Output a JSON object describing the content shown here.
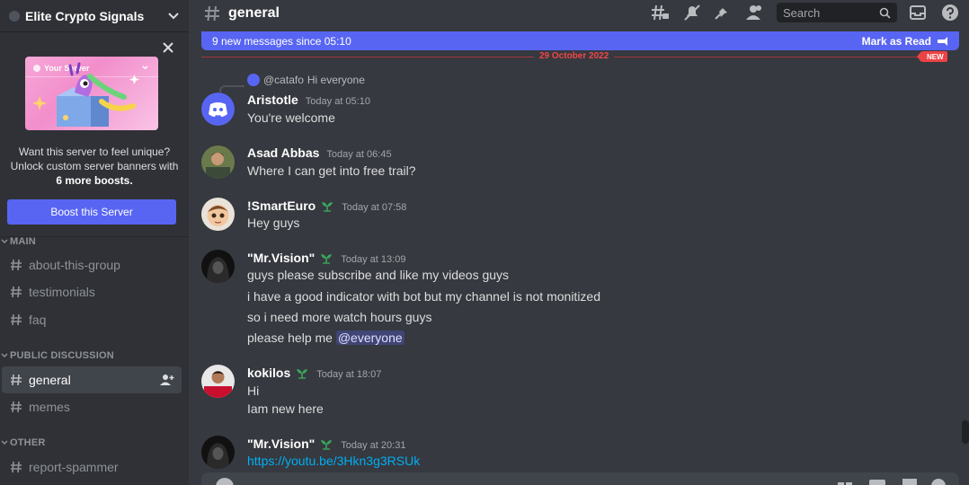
{
  "server": {
    "name": "Elite Crypto Signals"
  },
  "boost": {
    "preview_label": "Your Server",
    "line1": "Want this server to feel unique?",
    "line2": "Unlock custom server banners with",
    "line3": "6 more boosts.",
    "button": "Boost this Server"
  },
  "sidebar": {
    "categories": [
      {
        "label": "MAIN",
        "channels": [
          "about-this-group",
          "testimonials",
          "faq"
        ]
      },
      {
        "label": "PUBLIC DISCUSSION",
        "channels": [
          "general",
          "memes"
        ]
      },
      {
        "label": "OTHER",
        "channels": [
          "report-spammer"
        ]
      }
    ],
    "active_channel": "general"
  },
  "topbar": {
    "channel": "general",
    "search_placeholder": "Search",
    "icons": [
      "threads-icon",
      "mute-icon",
      "pin-icon",
      "members-icon",
      "inbox-icon",
      "help-icon"
    ]
  },
  "new_messages": {
    "text": "9 new messages since 05:10",
    "mark_read": "Mark as Read",
    "date": "29 October 2022",
    "tag": "NEW"
  },
  "reply": {
    "user": "@catafo",
    "text": "Hi everyone"
  },
  "messages": [
    {
      "author": "Aristotle",
      "time": "Today at 05:10",
      "lines": [
        "You're welcome"
      ]
    },
    {
      "author": "Asad Abbas",
      "time": "Today at 06:45",
      "lines": [
        "Where I can get into free trail?"
      ]
    },
    {
      "author": "!SmartEuro",
      "time": "Today at 07:58",
      "lines": [
        "Hey guys"
      ]
    },
    {
      "author": "\"Mr.Vision\"",
      "time": "Today at 13:09",
      "lines": [
        "guys please subscribe and like my videos guys",
        "i have a good indicator with bot but my channel is not monitized",
        "so i need more watch hours guys",
        "please help me"
      ],
      "mention": "@everyone"
    },
    {
      "author": "kokilos",
      "time": "Today at 18:07",
      "lines": [
        "Hi",
        "Iam new here"
      ]
    },
    {
      "author": "\"Mr.Vision\"",
      "time": "Today at 20:31",
      "link": "https://youtu.be/3Hkn3g3RSUk"
    }
  ],
  "colors": {
    "accent": "#5865f2",
    "new_red": "#ed4245",
    "link": "#00aff4",
    "sprout": "#3ba55c"
  }
}
